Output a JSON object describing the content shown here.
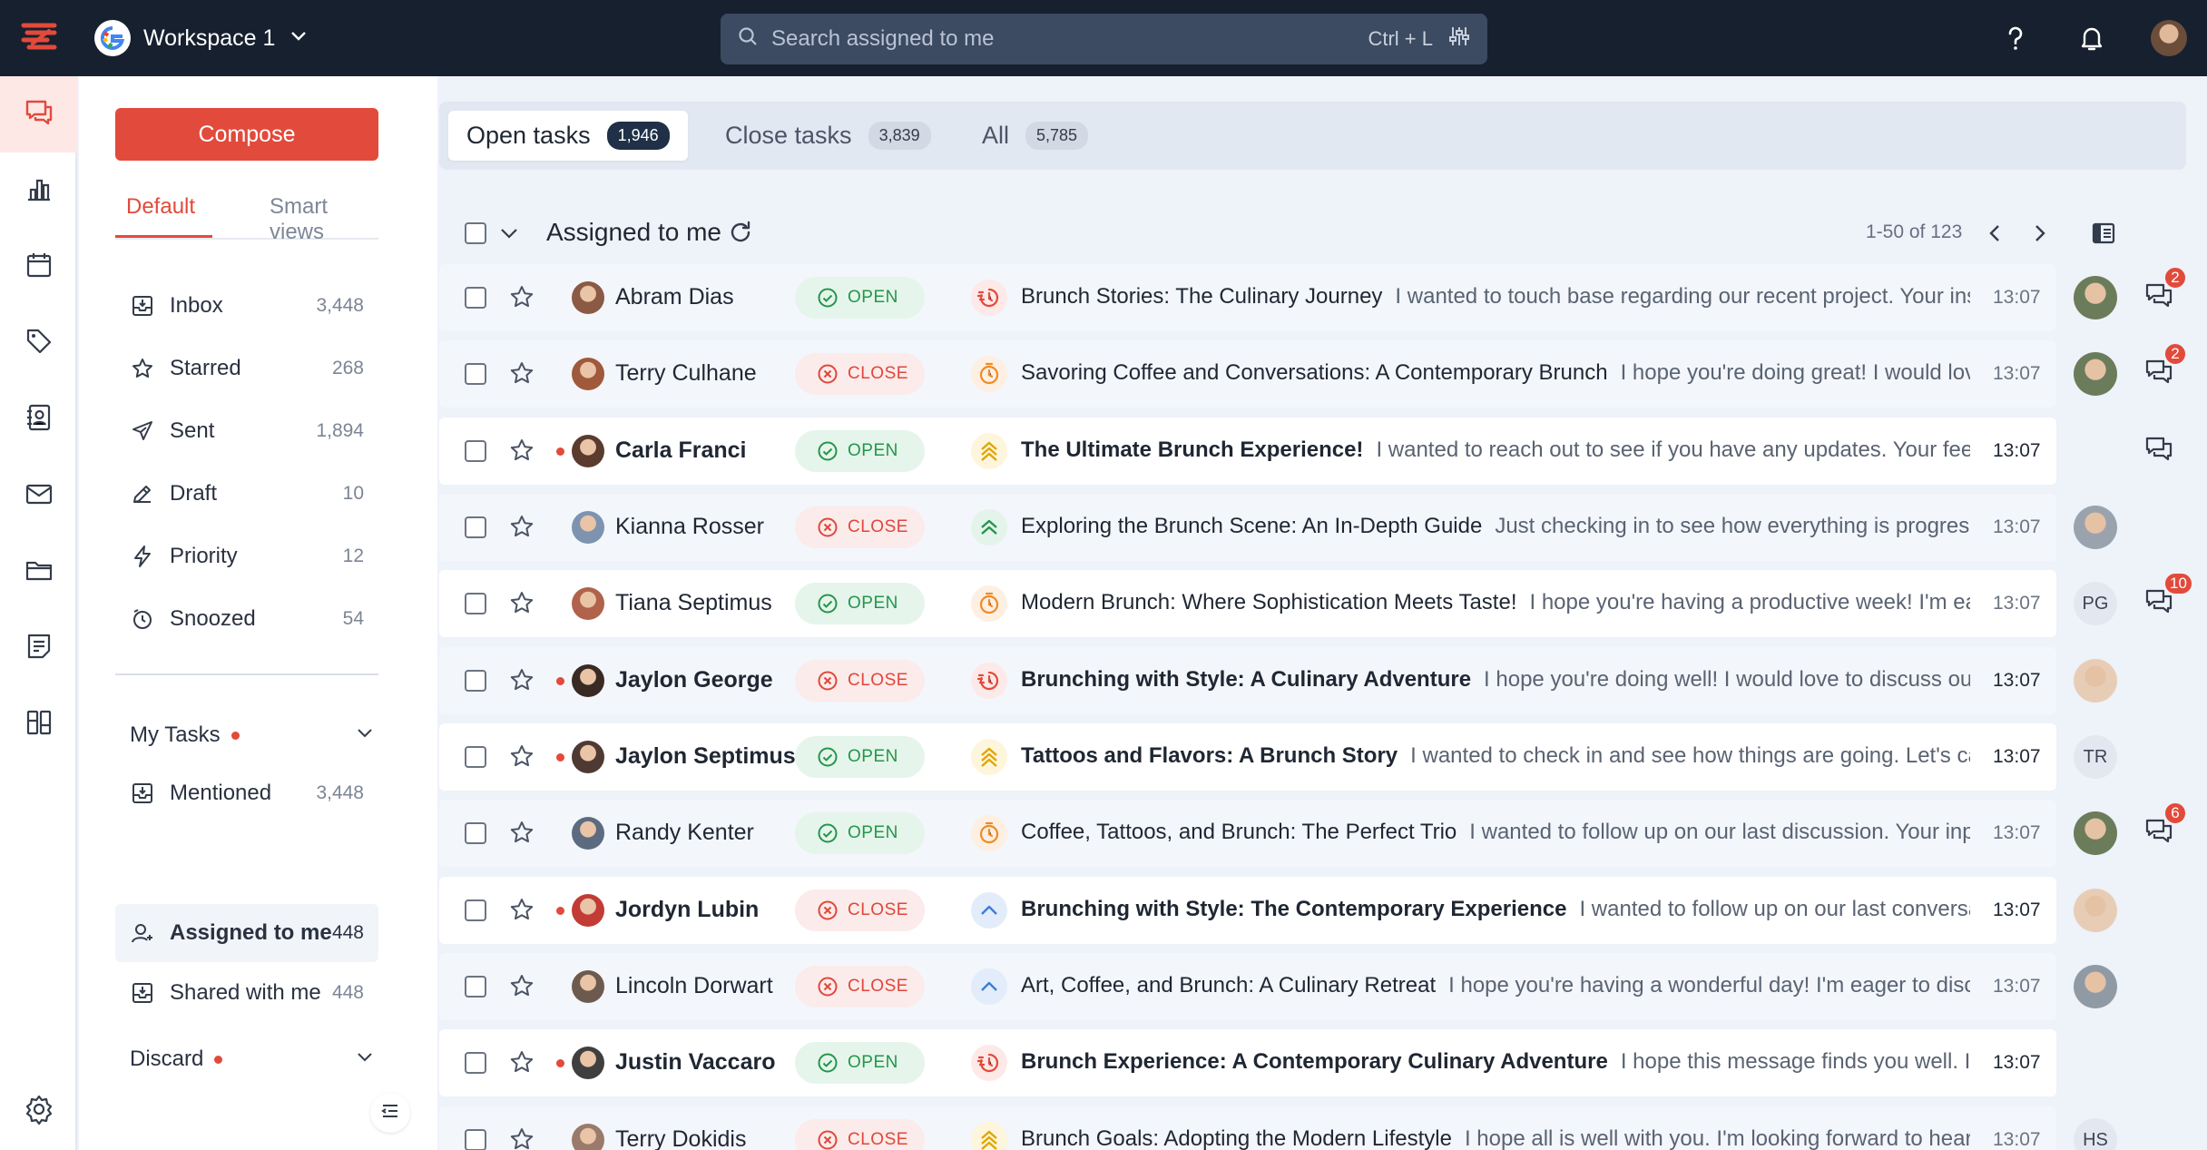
{
  "topbar": {
    "workspace": "Workspace 1",
    "search_placeholder": "Search assigned to me",
    "search_shortcut": "Ctrl + L",
    "icons": [
      "help-icon",
      "bell-icon",
      "user-avatar"
    ]
  },
  "rail": {
    "items": [
      "chat-icon",
      "bar-chart-icon",
      "calendar-icon",
      "tag-icon",
      "contact-icon",
      "mail-icon",
      "folder-icon",
      "notes-icon",
      "columns-icon"
    ],
    "settings": "settings-icon"
  },
  "sidebar": {
    "compose": "Compose",
    "views": {
      "default": "Default",
      "smart": "Smart views"
    },
    "folders": [
      {
        "label": "Inbox",
        "count": "3,448",
        "icon": "inbox-icon"
      },
      {
        "label": "Starred",
        "count": "268",
        "icon": "star-icon"
      },
      {
        "label": "Sent",
        "count": "1,894",
        "icon": "send-icon"
      },
      {
        "label": "Draft",
        "count": "10",
        "icon": "pencil-icon"
      },
      {
        "label": "Priority",
        "count": "12",
        "icon": "bolt-icon"
      },
      {
        "label": "Snoozed",
        "count": "54",
        "icon": "snooze-icon"
      }
    ],
    "my_tasks": "My Tasks",
    "task_folders": [
      {
        "label": "Mentioned",
        "count": "3,448",
        "icon": "inbox-icon"
      },
      {
        "label": "Assigned to me",
        "count": "448",
        "icon": "user-assign-icon"
      },
      {
        "label": "Shared with me",
        "count": "448",
        "icon": "inbox-icon"
      }
    ],
    "discard": "Discard"
  },
  "tabs": [
    {
      "label": "Open tasks",
      "count": "1,946"
    },
    {
      "label": "Close tasks",
      "count": "3,839"
    },
    {
      "label": "All",
      "count": "5,785"
    }
  ],
  "list": {
    "title": "Assigned to me",
    "pager": "1-50 of 123"
  },
  "colors": {
    "accent": "#e24a3b",
    "open": "#23964a",
    "close": "#e0473a",
    "topbar": "#17202e"
  },
  "rows": [
    {
      "name": "Abram Dias",
      "status": "OPEN",
      "subject": "Brunch Stories: The Culinary Journey",
      "preview": "I wanted to touch base regarding our recent project. Your insight",
      "time": "13:07",
      "unread": false,
      "priority": "timer",
      "assignee": "photo",
      "chat_count": "2"
    },
    {
      "name": "Terry Culhane",
      "status": "CLOSE",
      "subject": "Savoring Coffee and Conversations: A Contemporary Brunch",
      "preview": "I hope you're doing great! I would love to",
      "time": "13:07",
      "unread": false,
      "priority": "stopwatch",
      "assignee": "photo",
      "chat_count": "2"
    },
    {
      "name": "Carla Franci",
      "status": "OPEN",
      "subject": "The Ultimate Brunch Experience!",
      "preview": "I wanted to reach out to see if you have any updates. Your feedback",
      "time": "13:07",
      "unread": true,
      "priority": "highest",
      "assignee": "",
      "chat_count": ""
    },
    {
      "name": "Kianna Rosser",
      "status": "CLOSE",
      "subject": "Exploring the Brunch Scene: An In-Depth Guide",
      "preview": "Just checking in to see how everything is progressing",
      "time": "13:07",
      "unread": false,
      "priority": "high",
      "assignee": "photo",
      "chat_count": null
    },
    {
      "name": "Tiana Septimus",
      "status": "OPEN",
      "subject": "Modern Brunch: Where Sophistication Meets Taste!",
      "preview": "I hope you're having a productive week! I'm eager",
      "time": "13:07",
      "unread": false,
      "priority": "stopwatch",
      "assignee": "PG",
      "chat_count": "10"
    },
    {
      "name": "Jaylon George",
      "status": "CLOSE",
      "subject": "Brunching with Style: A Culinary Adventure",
      "preview": "I hope you're doing well! I would love to discuss our project",
      "time": "13:07",
      "unread": true,
      "priority": "timer",
      "assignee": "photo",
      "chat_count": null
    },
    {
      "name": "Jaylon Septimus",
      "status": "OPEN",
      "subject": "Tattoos and Flavors: A Brunch Story",
      "preview": "I wanted to check in and see how things are going. Let's catch up",
      "time": "13:07",
      "unread": true,
      "priority": "highest",
      "assignee": "TR",
      "chat_count": null
    },
    {
      "name": "Randy Kenter",
      "status": "OPEN",
      "subject": "Coffee, Tattoos, and Brunch: The Perfect Trio",
      "preview": "I wanted to follow up on our last discussion. Your input v",
      "time": "13:07",
      "unread": false,
      "priority": "stopwatch",
      "assignee": "photo",
      "chat_count": "6"
    },
    {
      "name": "Jordyn Lubin",
      "status": "CLOSE",
      "subject": "Brunching with Style: The Contemporary Experience",
      "preview": "I wanted to follow up on our last conversation. I",
      "time": "13:07",
      "unread": true,
      "priority": "medium",
      "assignee": "photo",
      "chat_count": null
    },
    {
      "name": "Lincoln Dorwart",
      "status": "CLOSE",
      "subject": "Art, Coffee, and Brunch: A Culinary Retreat",
      "preview": "I hope you're having a wonderful day! I'm eager to discuss",
      "time": "13:07",
      "unread": false,
      "priority": "medium",
      "assignee": "photo",
      "chat_count": null
    },
    {
      "name": "Justin Vaccaro",
      "status": "OPEN",
      "subject": "Brunch Experience: A Contemporary Culinary Adventure",
      "preview": "I hope this message finds you well. I'm reach",
      "time": "13:07",
      "unread": true,
      "priority": "timer",
      "assignee": "",
      "chat_count": null
    },
    {
      "name": "Terry Dokidis",
      "status": "CLOSE",
      "subject": "Brunch Goals: Adopting the Modern Lifestyle",
      "preview": "I hope all is well with you. I'm looking forward to hearin",
      "time": "13:07",
      "unread": false,
      "priority": "highest",
      "assignee": "HS",
      "chat_count": null
    }
  ]
}
